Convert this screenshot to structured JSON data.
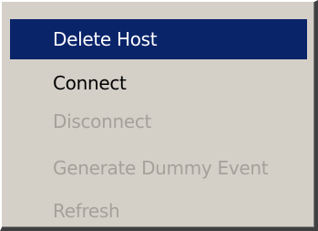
{
  "context_menu": {
    "items": [
      {
        "label": "Delete Host",
        "state": "highlighted"
      },
      {
        "label": "Connect",
        "state": "enabled"
      },
      {
        "label": "Disconnect",
        "state": "disabled"
      },
      {
        "label": "Generate Dummy Event",
        "state": "disabled"
      },
      {
        "label": "Refresh",
        "state": "disabled"
      }
    ]
  },
  "colors": {
    "menu_background": "#d4d0c8",
    "highlight_background": "#0a246a",
    "highlight_text": "#ffffff",
    "enabled_text": "#000000",
    "disabled_text": "#a5a19a"
  }
}
